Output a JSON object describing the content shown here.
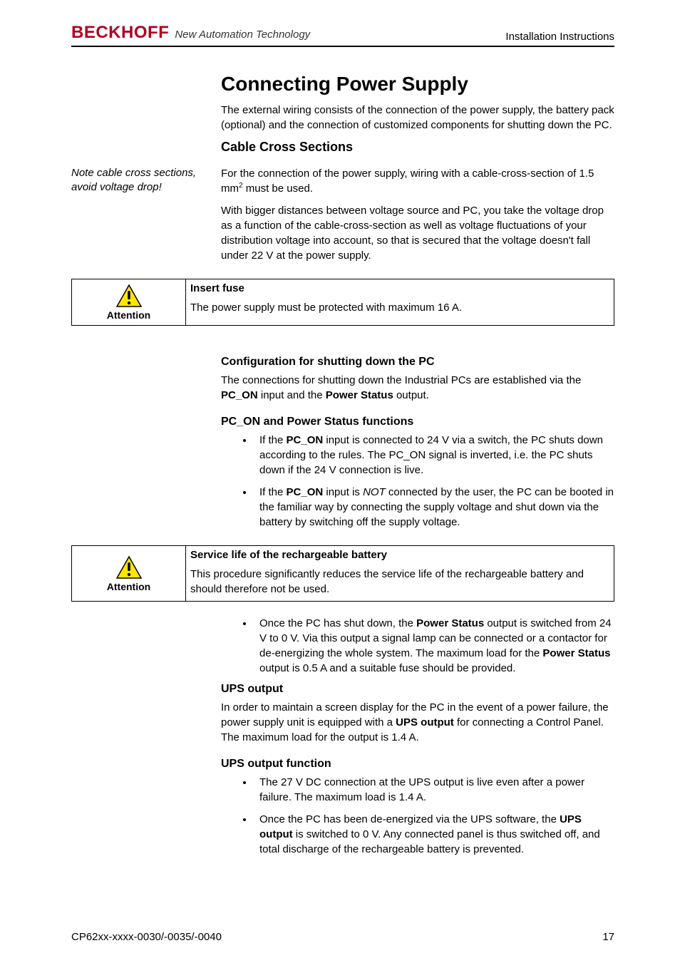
{
  "header": {
    "logo": "BECKHOFF",
    "tagline": "New Automation Technology",
    "section": "Installation Instructions"
  },
  "main": {
    "title": "Connecting Power Supply",
    "intro": "The external wiring consists of the connection of the power supply, the battery pack (optional) and the connection of customized components for shutting down the PC.",
    "cable_cross_title": "Cable Cross Sections",
    "cable_cross_side_note": "Note cable cross sections, avoid voltage drop!",
    "cable_cross_p1_part1": "For the connection of the power supply, wiring  with a cable-cross-section of 1.5 mm",
    "cable_cross_p1_sup": "2",
    "cable_cross_p1_part2": "  must be used.",
    "cable_cross_p2": "With bigger distances between voltage source and PC, you take the voltage drop as a function of the cable-cross-section as well as voltage fluctuations of your distribution voltage into account, so that is secured that the voltage doesn't fall under 22 V at the power supply.",
    "attention1": {
      "label": "Attention",
      "title": "Insert fuse",
      "body": "The power supply must be protected with maximum 16 A."
    },
    "config_title": "Configuration for shutting down the PC",
    "config_body_p1_a": "The connections for shutting down the Industrial PCs are established via the ",
    "config_body_p1_b": "PC_ON",
    "config_body_p1_c": " input and the ",
    "config_body_p1_d": "Power Status",
    "config_body_p1_e": " output.",
    "pc_on_title": "PC_ON and Power Status functions",
    "pc_on_bullet1_a": "If the ",
    "pc_on_bullet1_b": "PC_ON",
    "pc_on_bullet1_c": " input is connected to 24 V via a switch, the PC shuts down according to the rules. The PC_ON signal is inverted, i.e. the PC shuts down if the 24 V connection is live.",
    "pc_on_bullet2_a": "If the ",
    "pc_on_bullet2_b": "PC_ON",
    "pc_on_bullet2_c": " input is ",
    "pc_on_bullet2_d": "NOT",
    "pc_on_bullet2_e": " connected by the user, the PC can be booted in the familiar way by connecting the supply voltage and shut down via the battery by switching off the supply voltage.",
    "attention2": {
      "label": "Attention",
      "title": "Service life of the rechargeable battery",
      "body": "This procedure significantly reduces the service life of the rechargeable battery and should therefore not be used."
    },
    "post_att_bullet_a": "Once the PC has shut down, the ",
    "post_att_bullet_b": "Power Status",
    "post_att_bullet_c": " output is switched from 24 V to 0 V. Via this output a signal lamp can be connected or a contactor for de-energizing the whole system. The maximum load for the ",
    "post_att_bullet_d": "Power Status",
    "post_att_bullet_e": " output is 0.5 A and a suitable fuse should be provided.",
    "ups_title": "UPS output",
    "ups_body_a": "In order to maintain a screen display for the PC in the event of a power failure, the power supply unit is equipped with a ",
    "ups_body_b": "UPS output",
    "ups_body_c": " for connecting a Control Panel. The maximum load for the output is 1.4 A.",
    "ups_func_title": "UPS output function",
    "ups_func_bullet1": "The 27 V DC connection at the UPS output is live even after a power failure. The maximum load is 1.4 A.",
    "ups_func_bullet2_a": "Once the PC has been de-energized via the UPS software, the ",
    "ups_func_bullet2_b": "UPS output",
    "ups_func_bullet2_c": " is switched to 0 V. Any connected panel is thus switched off, and total discharge of the rechargeable battery is prevented."
  },
  "footer": {
    "left": "CP62xx-xxxx-0030/-0035/-0040",
    "right": "17"
  },
  "icons": {
    "attention": "attention-icon"
  }
}
